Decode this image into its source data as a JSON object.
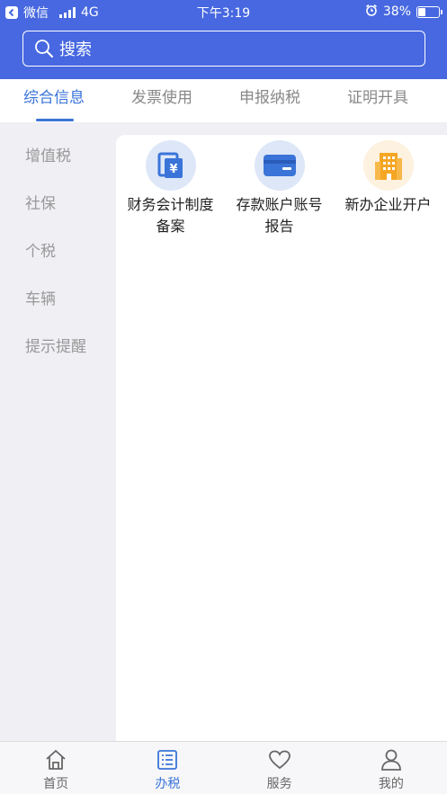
{
  "status_bar": {
    "back_app": "微信",
    "network": "4G",
    "time": "下午3:19",
    "battery_percent": "38%",
    "battery_level": 0.38
  },
  "search": {
    "placeholder": "搜索"
  },
  "tabs": [
    {
      "label": "综合信息",
      "active": true
    },
    {
      "label": "发票使用",
      "active": false
    },
    {
      "label": "申报纳税",
      "active": false
    },
    {
      "label": "证明开具",
      "active": false
    }
  ],
  "sidebar": {
    "items": [
      {
        "label": "增值税"
      },
      {
        "label": "社保"
      },
      {
        "label": "个税"
      },
      {
        "label": "车辆"
      },
      {
        "label": "提示提醒"
      }
    ]
  },
  "services": [
    {
      "label": "财务会计制度备案",
      "icon": "finance-document-icon"
    },
    {
      "label": "存款账户账号报告",
      "icon": "bank-card-icon"
    },
    {
      "label": "新办企业开户",
      "icon": "building-icon"
    }
  ],
  "colors": {
    "brand": "#4768e0",
    "accent": "#3a74d8",
    "building_orange": "#f5a623"
  },
  "bottom_nav": {
    "items": [
      {
        "label": "首页",
        "icon": "home-icon",
        "active": false
      },
      {
        "label": "办税",
        "icon": "list-icon",
        "active": true
      },
      {
        "label": "服务",
        "icon": "heart-icon",
        "active": false
      },
      {
        "label": "我的",
        "icon": "user-icon",
        "active": false
      }
    ]
  }
}
